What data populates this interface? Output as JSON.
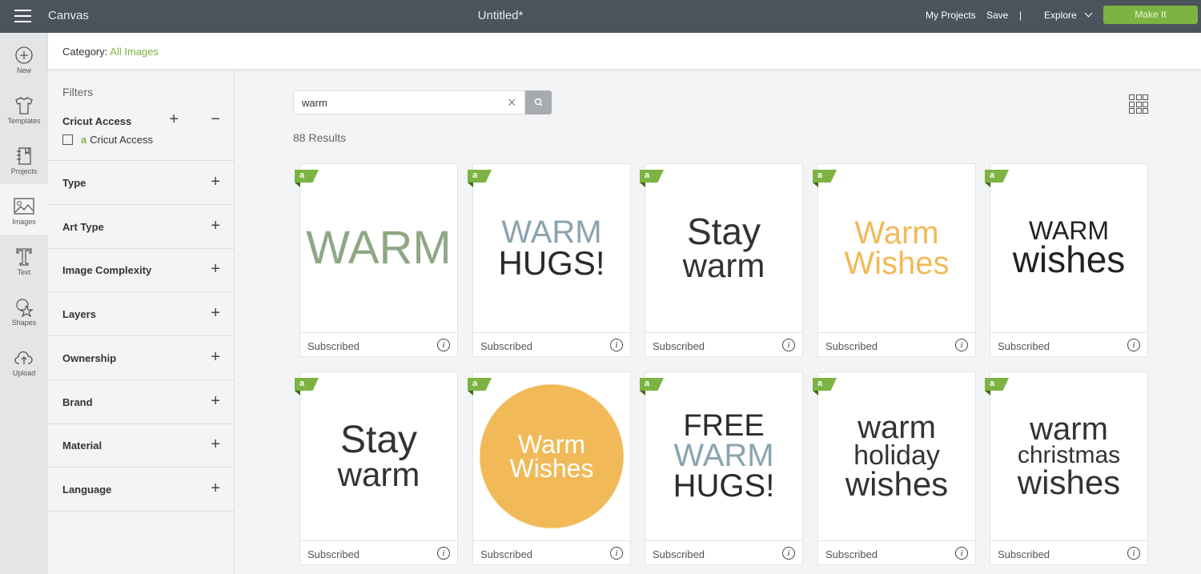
{
  "topbar": {
    "app_name": "Canvas",
    "doc_title": "Untitled*",
    "my_projects": "My Projects",
    "save": "Save",
    "divider": "|",
    "explore": "Explore",
    "make_it": "Make It"
  },
  "rail": [
    {
      "label": "New",
      "icon": "plus-circle-icon"
    },
    {
      "label": "Templates",
      "icon": "shirt-icon"
    },
    {
      "label": "Projects",
      "icon": "notebook-icon"
    },
    {
      "label": "Images",
      "icon": "image-icon"
    },
    {
      "label": "Text",
      "icon": "text-icon"
    },
    {
      "label": "Shapes",
      "icon": "shapes-icon"
    },
    {
      "label": "Upload",
      "icon": "cloud-upload-icon"
    }
  ],
  "category": {
    "label": "Category:",
    "value": "All Images"
  },
  "filters": {
    "title": "Filters",
    "access": {
      "title": "Cricut Access",
      "option": "Cricut Access",
      "checked": false
    },
    "sections": [
      "Type",
      "Art Type",
      "Image Complexity",
      "Layers",
      "Ownership",
      "Brand",
      "Material",
      "Language"
    ]
  },
  "search": {
    "value": "warm",
    "results": "88 Results"
  },
  "colors": {
    "accent": "#7cb342",
    "topbar": "#4b545c"
  },
  "cards": [
    {
      "art": [
        "WARM"
      ],
      "status": "Subscribed"
    },
    {
      "art": [
        "WARM",
        "HUGS!"
      ],
      "status": "Subscribed"
    },
    {
      "art": [
        "Stay",
        "warm"
      ],
      "status": "Subscribed"
    },
    {
      "art": [
        "Warm",
        "Wishes"
      ],
      "status": "Subscribed"
    },
    {
      "art": [
        "WARM",
        "wishes"
      ],
      "status": "Subscribed"
    },
    {
      "art": [
        "Stay",
        "warm"
      ],
      "status": "Subscribed"
    },
    {
      "art": [
        "Warm",
        "Wishes"
      ],
      "status": "Subscribed"
    },
    {
      "art": [
        "FREE",
        "WARM",
        "HUGS!"
      ],
      "status": "Subscribed"
    },
    {
      "art": [
        "warm",
        "holiday",
        "wishes"
      ],
      "status": "Subscribed"
    },
    {
      "art": [
        "warm",
        "christmas",
        "wishes"
      ],
      "status": "Subscribed"
    }
  ]
}
